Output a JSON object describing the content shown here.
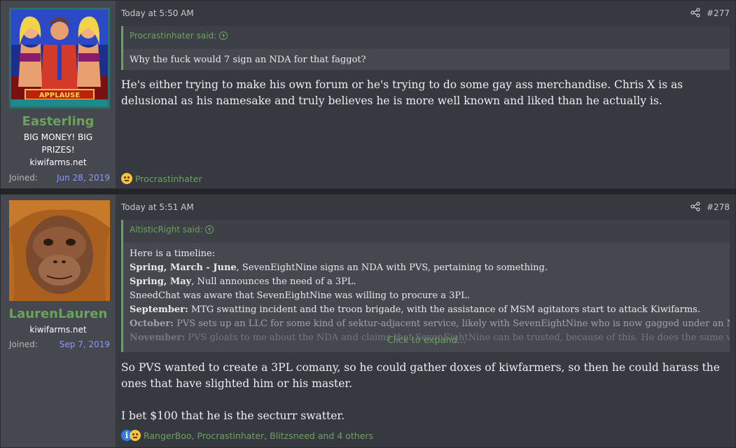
{
  "posts": [
    {
      "user": {
        "name": "Easterling",
        "title": "BIG MONEY! BIG PRIZES!",
        "site": "kiwifarms.net",
        "joined_label": "Joined:",
        "joined_date": "Jun 28, 2019",
        "avatar_caption": "APPLAUSE"
      },
      "timestamp": "Today at 5:50 AM",
      "post_number": "#277",
      "quote": {
        "author": "Procrastinhater said:",
        "lines": [
          "Why the fuck would 7 sign an NDA for that faggot?"
        ]
      },
      "message": [
        "He's either trying to make his own forum or he's trying to do some gay ass merchandise. Chris X is as delusional as his namesake and truly believes he is more well known and liked than he actually is."
      ],
      "reactions": {
        "icons": [
          "thinking-emoji"
        ],
        "text": "Procrastinhater"
      }
    },
    {
      "user": {
        "name": "LaurenLauren",
        "site": "kiwifarms.net",
        "joined_label": "Joined:",
        "joined_date": "Sep 7, 2019"
      },
      "timestamp": "Today at 5:51 AM",
      "post_number": "#278",
      "quote": {
        "author": "AltisticRight said:",
        "intro": "Here is a timeline:",
        "entries": [
          {
            "bold": "Spring, March - June",
            "text": ", SevenEightNine signs an NDA with PVS, pertaining to something."
          },
          {
            "bold": "Spring, May",
            "text": ", Null announces the need of a 3PL."
          },
          {
            "bold": "",
            "text": "SneedChat was aware that SevenEightNine was willing to procure a 3PL."
          },
          {
            "bold": "September:",
            "text": " MTG swatting incident and the troon brigade, with the assistance of MSM agitators start to attack Kiwifarms."
          },
          {
            "bold": "October:",
            "text": " PVS sets up an LLC for some kind of sektur-adjacent service, likely with SevenEightNine who is now gagged under an NDA."
          },
          {
            "bold": "November:",
            "text": " PVS gloats to me about the NDA and claims that SevenEightNine can be trusted, because of this. He does the same with"
          }
        ],
        "expand_label": "Click to expand..."
      },
      "message": [
        "So PVS wanted to create a 3PL comany, so he could gather doxes of kiwfarmers, so then he could harass the ones that have slighted him or his master.",
        "I bet $100 that he is the secturr swatter."
      ],
      "reactions": {
        "icons": [
          "informative-emoji",
          "thinking-emoji"
        ],
        "text": "RangerBoo, Procrastinhater, Blitzsneed and 4 others"
      }
    }
  ],
  "colors": {
    "page_bg": "#232428",
    "post_bg": "#363940",
    "userbox_bg": "#45484f",
    "username": "#6ba35a",
    "link": "#6ba35a",
    "joined_date": "#8f97ff"
  }
}
